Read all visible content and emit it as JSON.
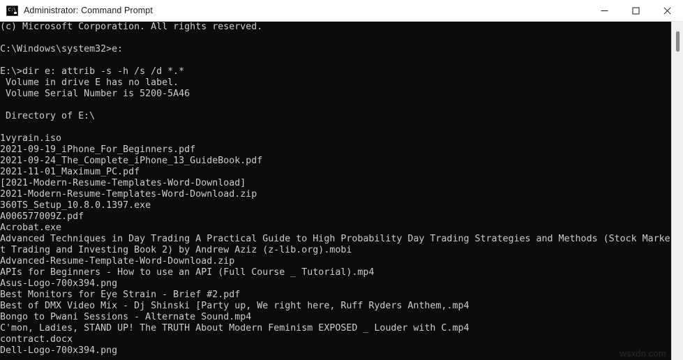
{
  "window": {
    "title": "Administrator: Command Prompt",
    "icon": "command-prompt-icon",
    "icon_glyph": "C:\\",
    "background_color": "#0c0c0c",
    "foreground_color": "#cccccc",
    "titlebar_color": "#ffffff"
  },
  "titlebar_buttons": {
    "minimize": "minimize-icon",
    "maximize": "maximize-icon",
    "close": "close-icon"
  },
  "console": {
    "lines": [
      "(c) Microsoft Corporation. All rights reserved.",
      "",
      "C:\\Windows\\system32>e:",
      "",
      "E:\\>dir e: attrib -s -h /s /d *.*",
      " Volume in drive E has no label.",
      " Volume Serial Number is 5200-5A46",
      "",
      " Directory of E:\\",
      "",
      "1vyrain.iso",
      "2021-09-19_iPhone_For_Beginners.pdf",
      "2021-09-24_The_Complete_iPhone_13_GuideBook.pdf",
      "2021-11-01_Maximum_PC.pdf",
      "[2021-Modern-Resume-Templates-Word-Download]",
      "2021-Modern-Resume-Templates-Word-Download.zip",
      "360TS_Setup_10.8.0.1397.exe",
      "A006577009Z.pdf",
      "Acrobat.exe",
      "Advanced Techniques in Day Trading A Practical Guide to High Probability Day Trading Strategies and Methods (Stock Marke",
      "t Trading and Investing Book 2) by Andrew Aziz (z-lib.org).mobi",
      "Advanced-Resume-Template-Word-Download.zip",
      "APIs for Beginners - How to use an API (Full Course _ Tutorial).mp4",
      "Asus-Logo-700x394.png",
      "Best Monitors for Eye Strain - Brief #2.pdf",
      "Best of DMX Video Mix - Dj Shinski [Party up, We right here, Ruff Ryders Anthem,.mp4",
      "Bongo to Pwani Sessions - Alternate Sound.mp4",
      "C'mon, Ladies, STAND UP! The TRUTH About Modern Feminism EXPOSED _ Louder with C.mp4",
      "contract.docx",
      "Dell-Logo-700x394.png"
    ]
  },
  "scrollbar": {
    "orientation": "vertical",
    "thumb_position_percent": 3
  },
  "watermark": {
    "text": "wsxdn.com"
  }
}
